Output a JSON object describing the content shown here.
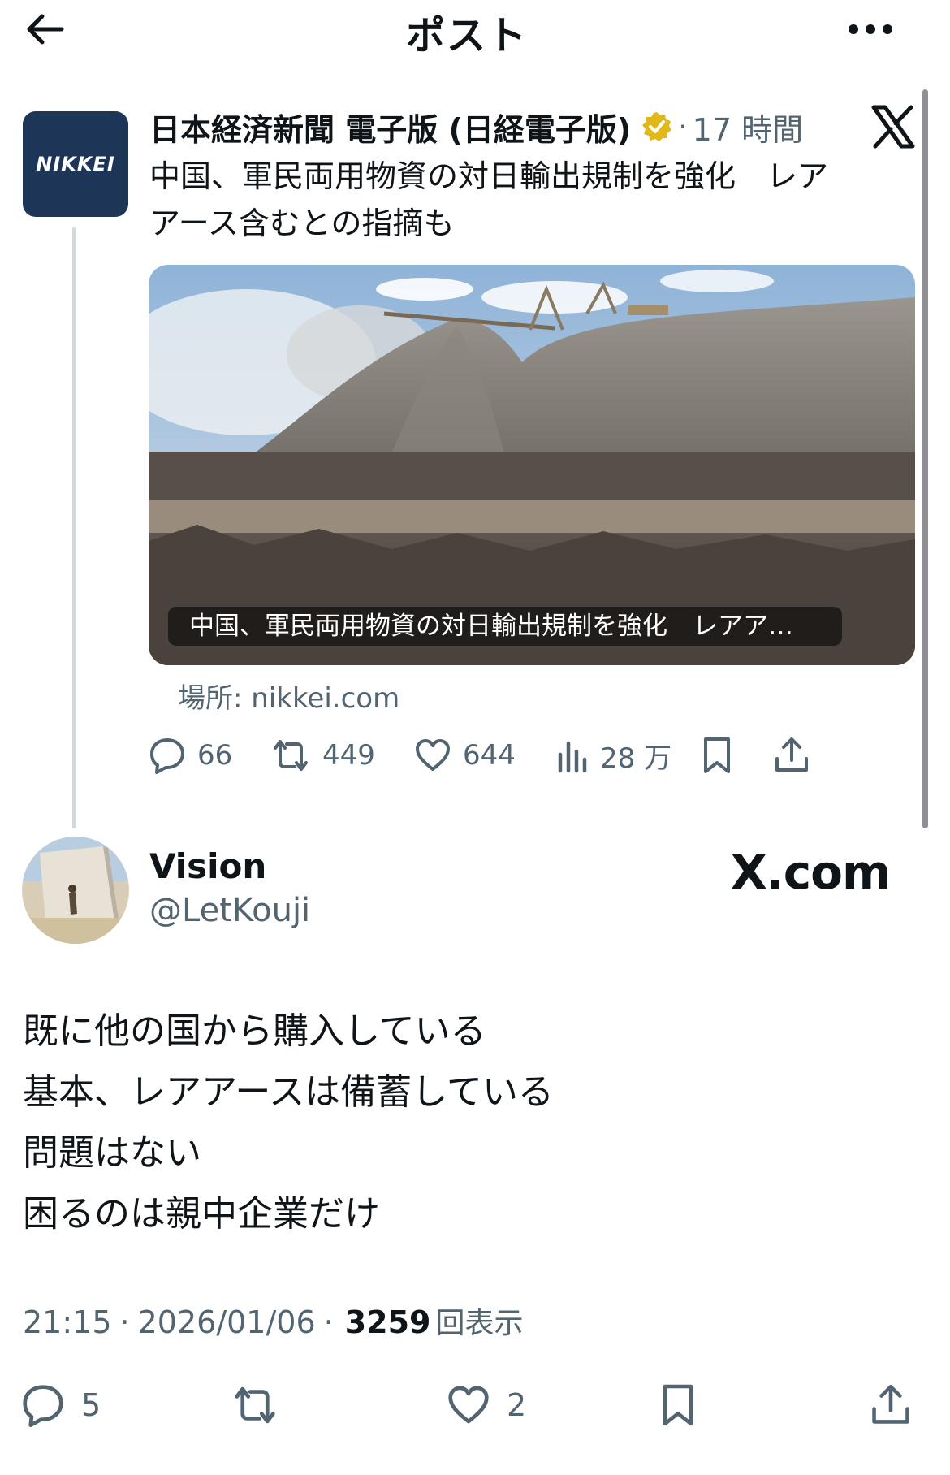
{
  "header": {
    "title": "ポスト",
    "back_icon": "arrow-left-icon",
    "more_icon": "more-horizontal-icon"
  },
  "quoted_post": {
    "avatar_text": "NIKKEI",
    "author": "日本経済新聞 電子版 (日経電子版)",
    "separator": "·",
    "time": "17 時間",
    "text_line1": "中国、軍民両用物資の対日輸出規制を強化　レア",
    "text_line2": "アース含むとの指摘も",
    "media_caption": "中国、軍民両用物資の対日輸出規制を強化　レアア…",
    "source": "場所: nikkei.com",
    "replies": "66",
    "reposts": "449",
    "likes": "644",
    "views": "28 万",
    "colors": {
      "avatar_bg": "#1d3557",
      "verified_badge": "#e2b719"
    }
  },
  "main_post": {
    "name": "Vision",
    "handle": "@LetKouji",
    "watermark": "X.com",
    "lines": [
      "既に他の国から購入している",
      "基本、レアアースは備蓄している",
      "問題はない",
      "困るのは親中企業だけ"
    ],
    "time": "21:15",
    "sep1": "·",
    "date": "2026/01/06",
    "sep2": "·",
    "views_count": "3259",
    "views_label": "回表示",
    "replies": "5",
    "likes": "2"
  }
}
